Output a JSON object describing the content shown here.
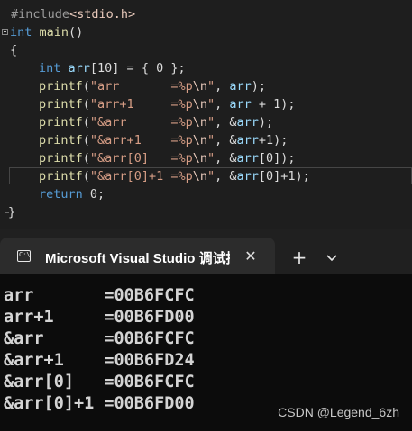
{
  "editor": {
    "code_lines": [
      {
        "tokens": [
          {
            "t": "#include",
            "c": "pre"
          },
          {
            "t": "<stdio.h>",
            "c": "inc"
          }
        ]
      },
      {
        "tokens": [
          {
            "t": "int",
            "c": "kw"
          },
          {
            "t": " ",
            "c": "punc"
          },
          {
            "t": "main",
            "c": "fn"
          },
          {
            "t": "()",
            "c": "punc"
          }
        ]
      },
      {
        "tokens": [
          {
            "t": "{",
            "c": "punc"
          }
        ]
      },
      {
        "tokens": [
          {
            "t": "int",
            "c": "kw"
          },
          {
            "t": " ",
            "c": "punc"
          },
          {
            "t": "arr",
            "c": "var"
          },
          {
            "t": "[10] = { 0 };",
            "c": "punc"
          }
        ]
      },
      {
        "tokens": [
          {
            "t": "printf",
            "c": "fn"
          },
          {
            "t": "(",
            "c": "punc"
          },
          {
            "t": "\"arr       =%p",
            "c": "str"
          },
          {
            "t": "\\n",
            "c": "esc"
          },
          {
            "t": "\"",
            "c": "str"
          },
          {
            "t": ", ",
            "c": "punc"
          },
          {
            "t": "arr",
            "c": "var"
          },
          {
            "t": ");",
            "c": "punc"
          }
        ]
      },
      {
        "tokens": [
          {
            "t": "printf",
            "c": "fn"
          },
          {
            "t": "(",
            "c": "punc"
          },
          {
            "t": "\"arr+1     =%p",
            "c": "str"
          },
          {
            "t": "\\n",
            "c": "esc"
          },
          {
            "t": "\"",
            "c": "str"
          },
          {
            "t": ", ",
            "c": "punc"
          },
          {
            "t": "arr",
            "c": "var"
          },
          {
            "t": " + 1);",
            "c": "punc"
          }
        ]
      },
      {
        "tokens": [
          {
            "t": "printf",
            "c": "fn"
          },
          {
            "t": "(",
            "c": "punc"
          },
          {
            "t": "\"&arr      =%p",
            "c": "str"
          },
          {
            "t": "\\n",
            "c": "esc"
          },
          {
            "t": "\"",
            "c": "str"
          },
          {
            "t": ", &",
            "c": "punc"
          },
          {
            "t": "arr",
            "c": "var"
          },
          {
            "t": ");",
            "c": "punc"
          }
        ]
      },
      {
        "tokens": [
          {
            "t": "printf",
            "c": "fn"
          },
          {
            "t": "(",
            "c": "punc"
          },
          {
            "t": "\"&arr+1    =%p",
            "c": "str"
          },
          {
            "t": "\\n",
            "c": "esc"
          },
          {
            "t": "\"",
            "c": "str"
          },
          {
            "t": ", &",
            "c": "punc"
          },
          {
            "t": "arr",
            "c": "var"
          },
          {
            "t": "+1);",
            "c": "punc"
          }
        ]
      },
      {
        "tokens": [
          {
            "t": "printf",
            "c": "fn"
          },
          {
            "t": "(",
            "c": "punc"
          },
          {
            "t": "\"&arr[0]   =%p",
            "c": "str"
          },
          {
            "t": "\\n",
            "c": "esc"
          },
          {
            "t": "\"",
            "c": "str"
          },
          {
            "t": ", &",
            "c": "punc"
          },
          {
            "t": "arr",
            "c": "var"
          },
          {
            "t": "[0]);",
            "c": "punc"
          }
        ]
      },
      {
        "tokens": [
          {
            "t": "printf",
            "c": "fn"
          },
          {
            "t": "(",
            "c": "punc"
          },
          {
            "t": "\"&arr[0]+1 =%p",
            "c": "str"
          },
          {
            "t": "\\n",
            "c": "esc"
          },
          {
            "t": "\"",
            "c": "str"
          },
          {
            "t": ", &",
            "c": "punc"
          },
          {
            "t": "arr",
            "c": "var"
          },
          {
            "t": "[0]+1);",
            "c": "punc"
          }
        ]
      },
      {
        "tokens": [
          {
            "t": "return",
            "c": "kw"
          },
          {
            "t": " 0;",
            "c": "punc"
          }
        ]
      },
      {
        "tokens": [
          {
            "t": "}",
            "c": "punc"
          }
        ]
      }
    ]
  },
  "terminal": {
    "tab_title": "Microsoft Visual Studio 调试控制台",
    "tab_icon_glyph": "C:\\",
    "close_glyph": "✕",
    "new_tab_glyph": "+",
    "output_lines": [
      "arr       =00B6FCFC",
      "arr+1     =00B6FD00",
      "&arr      =00B6FCFC",
      "&arr+1    =00B6FD24",
      "&arr[0]   =00B6FCFC",
      "&arr[0]+1 =00B6FD00"
    ]
  },
  "watermark": "CSDN @Legend_6zh",
  "colors": {
    "editor_bg": "#1e1e1e",
    "terminal_bg": "#0c0c0c",
    "tab_bg": "#2c2c2c",
    "keyword": "#569cd6",
    "function": "#dcdcaa",
    "string": "#d69d85"
  }
}
